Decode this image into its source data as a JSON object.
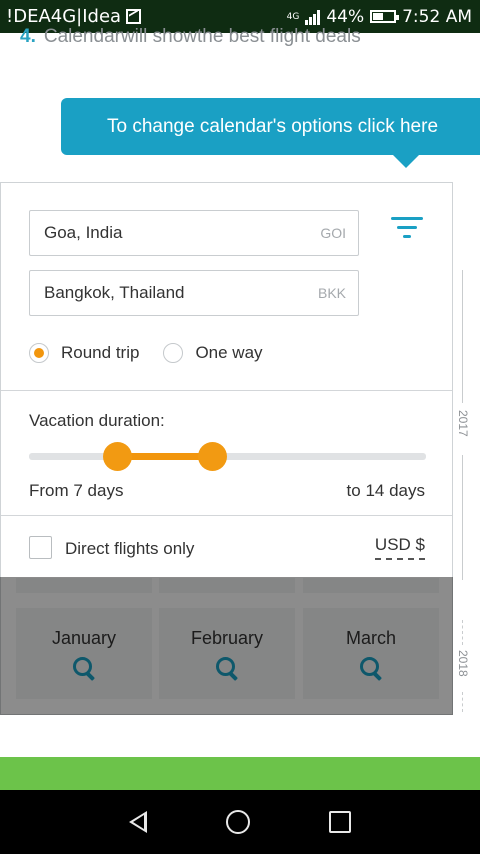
{
  "status_bar": {
    "carrier": "!DEA4G|Idea",
    "network": "4G",
    "battery": "44%",
    "time": "7:52 AM"
  },
  "step": {
    "number": "4.",
    "text": "Calendarwill showthe best flight deals"
  },
  "tooltip": {
    "text": "To change calendar's options click here"
  },
  "search": {
    "origin": {
      "city": "Goa, India",
      "code": "GOI"
    },
    "destination": {
      "city": "Bangkok, Thailand",
      "code": "BKK"
    },
    "trip_types": [
      {
        "label": "Round trip",
        "selected": true
      },
      {
        "label": "One way",
        "selected": false
      }
    ]
  },
  "duration": {
    "label": "Vacation duration:",
    "from_label": "From 7 days",
    "to_label": "to 14 days",
    "min_days": 7,
    "max_days": 14
  },
  "filters": {
    "direct_label": "Direct flights only",
    "direct_checked": false,
    "currency": "USD $"
  },
  "months": [
    "January",
    "February",
    "March"
  ],
  "timeline": {
    "year_a": "2017",
    "year_b": "2018"
  },
  "colors": {
    "accent": "#1aa0c4",
    "slider": "#f2960d",
    "green": "#6cc34a"
  }
}
